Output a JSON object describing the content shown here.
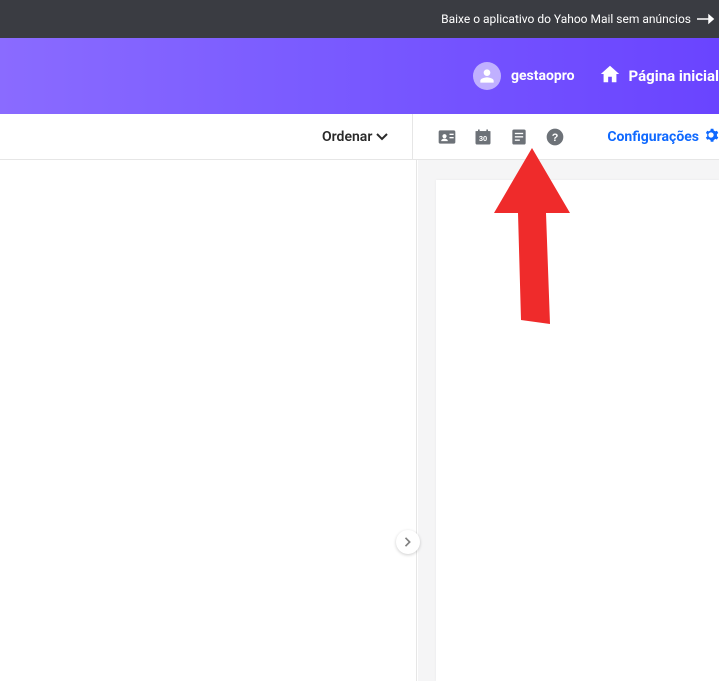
{
  "top_bar": {
    "promo_text": "Baixe o aplicativo do Yahoo Mail sem anúncios"
  },
  "header": {
    "username": "gestaopro",
    "home_label": "Página inicial"
  },
  "toolbar": {
    "sort_label": "Ordenar",
    "settings_label": "Configurações",
    "icons": {
      "contacts": "contacts-icon",
      "calendar": "calendar-icon",
      "calendar_day": "30",
      "notepad": "notepad-icon",
      "help": "help-icon"
    }
  }
}
